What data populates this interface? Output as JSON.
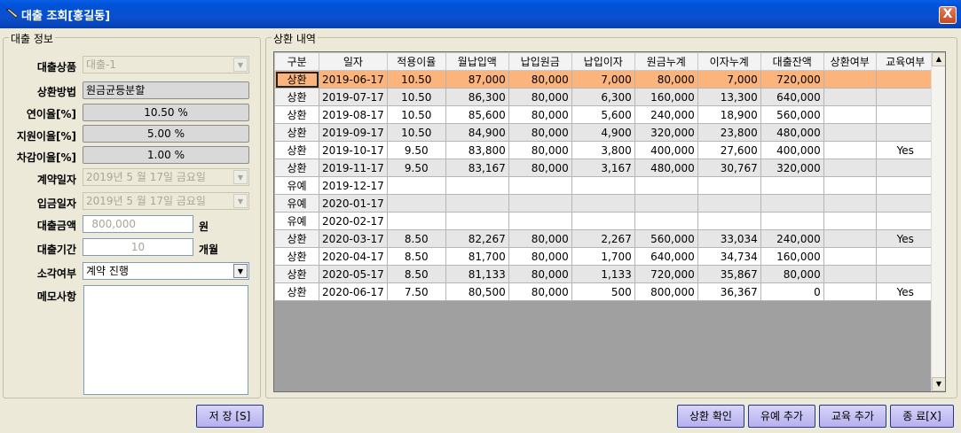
{
  "window": {
    "title": "대출 조회[홍길동]",
    "close_label": "X"
  },
  "info": {
    "group_title": "대출 정보",
    "loan_product": {
      "label": "대출상품",
      "value": "대출-1"
    },
    "repay_method": {
      "label": "상환방법",
      "value": "원금균등분할"
    },
    "annual_rate": {
      "label": "연이율[%]",
      "value": "10.50 %"
    },
    "support_rate": {
      "label": "지원이율[%]",
      "value": "5.00 %"
    },
    "diff_rate": {
      "label": "차감이율[%]",
      "value": "1.00 %"
    },
    "contract_date": {
      "label": "계약일자",
      "value": "2019년  5 월 17일 금요일"
    },
    "deposit_date": {
      "label": "입금일자",
      "value": "2019년  5 월 17일 금요일"
    },
    "loan_amount": {
      "label": "대출금액",
      "value": "800,000",
      "unit": "원"
    },
    "loan_period": {
      "label": "대출기간",
      "value": "10",
      "unit": "개월"
    },
    "writeoff": {
      "label": "소각여부",
      "value": "계약 진행"
    },
    "memo": {
      "label": "메모사항",
      "value": ""
    }
  },
  "history": {
    "group_title": "상환 내역",
    "columns": [
      "구분",
      "일자",
      "적용이율",
      "월납입액",
      "납입원금",
      "납입이자",
      "원금누계",
      "이자누계",
      "대출잔액",
      "상환여부",
      "교육여부"
    ],
    "rows": [
      [
        "상환",
        "2019-06-17",
        "10.50",
        "87,000",
        "80,000",
        "7,000",
        "80,000",
        "7,000",
        "720,000",
        "",
        ""
      ],
      [
        "상환",
        "2019-07-17",
        "10.50",
        "86,300",
        "80,000",
        "6,300",
        "160,000",
        "13,300",
        "640,000",
        "",
        ""
      ],
      [
        "상환",
        "2019-08-17",
        "10.50",
        "85,600",
        "80,000",
        "5,600",
        "240,000",
        "18,900",
        "560,000",
        "",
        ""
      ],
      [
        "상환",
        "2019-09-17",
        "10.50",
        "84,900",
        "80,000",
        "4,900",
        "320,000",
        "23,800",
        "480,000",
        "",
        ""
      ],
      [
        "상환",
        "2019-10-17",
        "9.50",
        "83,800",
        "80,000",
        "3,800",
        "400,000",
        "27,600",
        "400,000",
        "",
        "Yes"
      ],
      [
        "상환",
        "2019-11-17",
        "9.50",
        "83,167",
        "80,000",
        "3,167",
        "480,000",
        "30,767",
        "320,000",
        "",
        ""
      ],
      [
        "유예",
        "2019-12-17",
        "",
        "",
        "",
        "",
        "",
        "",
        "",
        "",
        ""
      ],
      [
        "유예",
        "2020-01-17",
        "",
        "",
        "",
        "",
        "",
        "",
        "",
        "",
        ""
      ],
      [
        "유예",
        "2020-02-17",
        "",
        "",
        "",
        "",
        "",
        "",
        "",
        "",
        ""
      ],
      [
        "상환",
        "2020-03-17",
        "8.50",
        "82,267",
        "80,000",
        "2,267",
        "560,000",
        "33,034",
        "240,000",
        "",
        "Yes"
      ],
      [
        "상환",
        "2020-04-17",
        "8.50",
        "81,700",
        "80,000",
        "1,700",
        "640,000",
        "34,734",
        "160,000",
        "",
        ""
      ],
      [
        "상환",
        "2020-05-17",
        "8.50",
        "81,133",
        "80,000",
        "1,133",
        "720,000",
        "35,867",
        "80,000",
        "",
        ""
      ],
      [
        "상환",
        "2020-06-17",
        "7.50",
        "80,500",
        "80,000",
        "500",
        "800,000",
        "36,367",
        "0",
        "",
        "Yes"
      ]
    ]
  },
  "buttons": {
    "save": "저 장 [S]",
    "confirm": "상환 확인",
    "defer": "유예 추가",
    "education": "교육 추가",
    "exit": "종 료[X]"
  }
}
